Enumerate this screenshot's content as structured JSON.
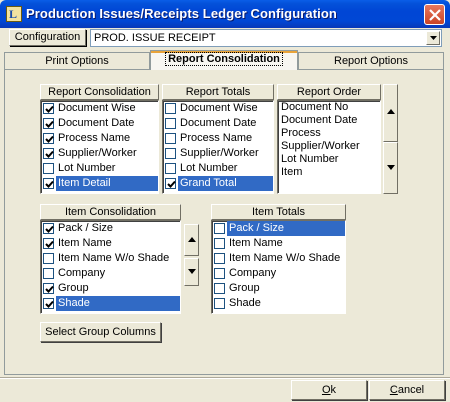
{
  "window": {
    "title": "Production Issues/Receipts Ledger Configuration"
  },
  "config": {
    "button_label": "Configuration",
    "selected_value": "PROD. ISSUE RECEIPT"
  },
  "tabs": [
    {
      "label": "Print Options",
      "active": false
    },
    {
      "label": "Report Consolidation",
      "active": true
    },
    {
      "label": "Report Options",
      "active": false
    }
  ],
  "report_consolidation": {
    "header": "Report Consolidation",
    "items": [
      {
        "label": "Document Wise",
        "checked": true,
        "selected": false
      },
      {
        "label": "Document Date",
        "checked": true,
        "selected": false
      },
      {
        "label": "Process Name",
        "checked": true,
        "selected": false
      },
      {
        "label": "Supplier/Worker",
        "checked": true,
        "selected": false
      },
      {
        "label": "Lot Number",
        "checked": false,
        "selected": false
      },
      {
        "label": "Item Detail",
        "checked": true,
        "selected": true
      }
    ]
  },
  "report_totals": {
    "header": "Report Totals",
    "items": [
      {
        "label": "Document Wise",
        "checked": false,
        "selected": false
      },
      {
        "label": "Document Date",
        "checked": false,
        "selected": false
      },
      {
        "label": "Process Name",
        "checked": false,
        "selected": false
      },
      {
        "label": "Supplier/Worker",
        "checked": false,
        "selected": false
      },
      {
        "label": "Lot Number",
        "checked": false,
        "selected": false
      },
      {
        "label": "Grand Total",
        "checked": true,
        "selected": true
      }
    ]
  },
  "report_order": {
    "header": "Report Order",
    "items": [
      "Document No",
      "Document Date",
      "Process",
      "Supplier/Worker",
      "Lot Number",
      "Item"
    ]
  },
  "item_consolidation": {
    "header": "Item Consolidation",
    "items": [
      {
        "label": "Pack / Size",
        "checked": true,
        "selected": false
      },
      {
        "label": "Item Name",
        "checked": true,
        "selected": false
      },
      {
        "label": "Item Name W/o Shade",
        "checked": false,
        "selected": false
      },
      {
        "label": "Company",
        "checked": false,
        "selected": false
      },
      {
        "label": "Group",
        "checked": true,
        "selected": false
      },
      {
        "label": "Shade",
        "checked": true,
        "selected": true
      }
    ]
  },
  "item_totals": {
    "header": "Item Totals",
    "items": [
      {
        "label": "Pack / Size",
        "checked": false,
        "selected": true
      },
      {
        "label": "Item Name",
        "checked": false,
        "selected": false
      },
      {
        "label": "Item Name W/o Shade",
        "checked": false,
        "selected": false
      },
      {
        "label": "Company",
        "checked": false,
        "selected": false
      },
      {
        "label": "Group",
        "checked": false,
        "selected": false
      },
      {
        "label": "Shade",
        "checked": false,
        "selected": false
      }
    ]
  },
  "buttons": {
    "select_group_columns": "Select Group Columns",
    "ok_accel": "O",
    "ok_rest": "k",
    "cancel_accel": "C",
    "cancel_rest": "ancel"
  },
  "colors": {
    "titlebar": "#0046d5",
    "selection": "#316ac5",
    "face": "#ece9d8"
  }
}
